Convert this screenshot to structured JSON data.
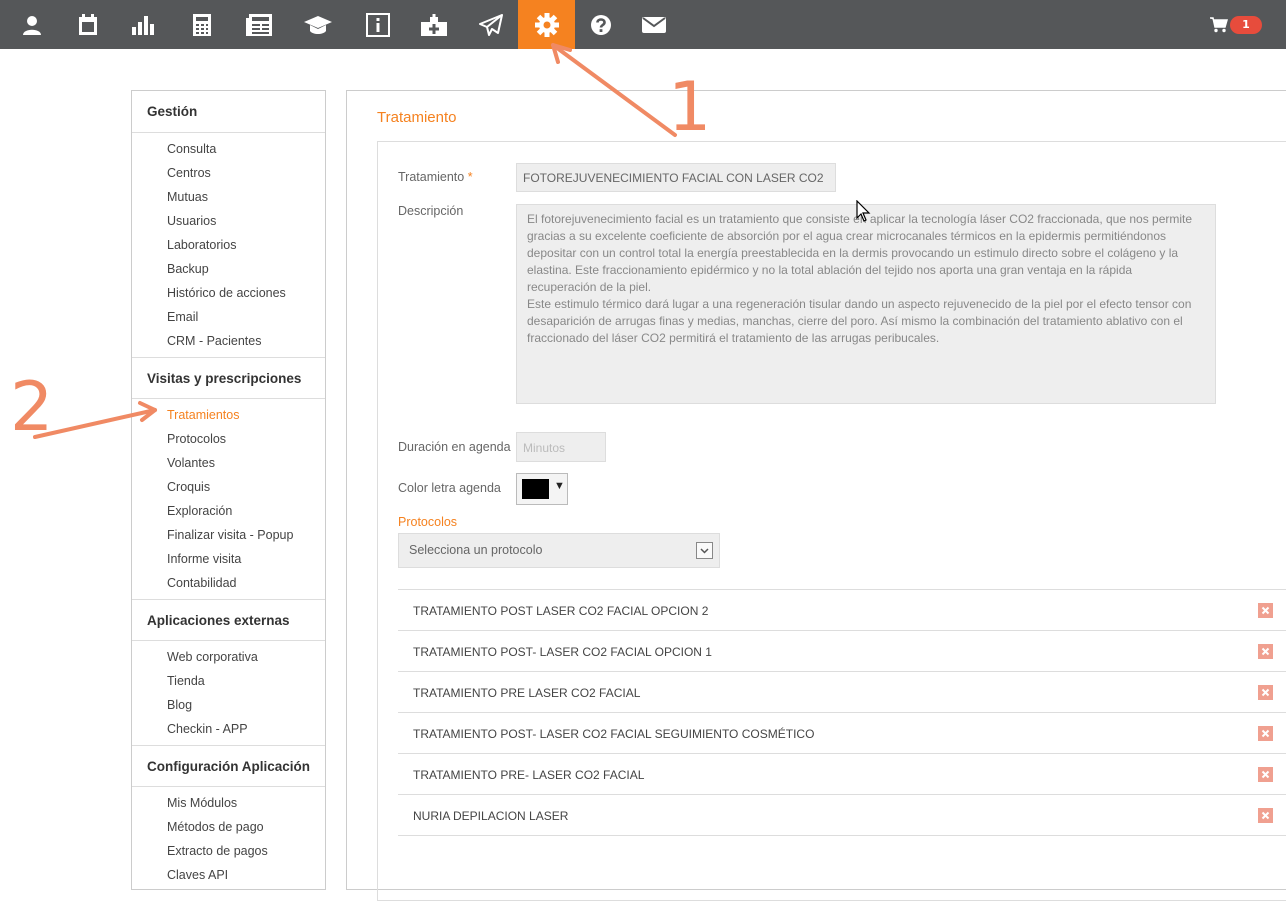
{
  "topbar": {
    "icons": [
      {
        "name": "user-icon"
      },
      {
        "name": "calendar-icon"
      },
      {
        "name": "bar-chart-icon"
      },
      {
        "name": "calculator-icon"
      },
      {
        "name": "newspaper-icon"
      },
      {
        "name": "graduation-cap-icon"
      },
      {
        "name": "info-icon"
      },
      {
        "name": "medkit-icon"
      },
      {
        "name": "paper-plane-icon"
      },
      {
        "name": "gear-icon"
      },
      {
        "name": "question-icon"
      },
      {
        "name": "envelope-icon"
      }
    ],
    "active_icon": "gear-icon",
    "active_color": "#f58220",
    "cart_count": "1"
  },
  "sidebar": {
    "sections": [
      {
        "title": "Gestión",
        "items": [
          "Consulta",
          "Centros",
          "Mutuas",
          "Usuarios",
          "Laboratorios",
          "Backup",
          "Histórico de acciones",
          "Email",
          "CRM - Pacientes"
        ]
      },
      {
        "title": "Visitas y prescripciones",
        "items": [
          "Tratamientos",
          "Protocolos",
          "Volantes",
          "Croquis",
          "Exploración",
          "Finalizar visita - Popup",
          "Informe visita",
          "Contabilidad"
        ]
      },
      {
        "title": "Aplicaciones externas",
        "items": [
          "Web corporativa",
          "Tienda",
          "Blog",
          "Checkin - APP"
        ]
      },
      {
        "title": "Configuración Aplicación",
        "items": [
          "Mis Módulos",
          "Métodos de pago",
          "Extracto de pagos",
          "Claves API"
        ]
      }
    ],
    "active_item": "Tratamientos"
  },
  "main": {
    "title": "Tratamiento",
    "form": {
      "tratamiento_label": "Tratamiento",
      "required_mark": "*",
      "tratamiento_value": "FOTOREJUVENECIMIENTO FACIAL CON LASER CO2",
      "descripcion_label": "Descripción",
      "descripcion_value": "El fotorejuvenecimiento facial es un tratamiento que consiste en aplicar la tecnología láser CO2 fraccionada, que nos permite\ngracias a su excelente coeficiente de absorción por el agua crear microcanales térmicos en la epidermis permitiéndonos\ndepositar con un control total la energía preestablecida en la dermis provocando un estimulo directo sobre el colágeno y la\nelastina. Este fraccionamiento epidérmico y no la total ablación del tejido nos aporta una gran ventaja en la rápida\nrecuperación de la piel.\nEste estimulo térmico dará lugar a una regeneración tisular dando un aspecto rejuvenecido de la piel por el efecto tensor con\ndesaparición de arrugas finas y medias, manchas, cierre del poro. Así mismo la combinación del tratamiento ablativo con el\nfraccionado del láser CO2 permitirá el tratamiento de las arrugas peribucales.",
      "duracion_label": "Duración en agenda",
      "duracion_placeholder": "Minutos",
      "color_label": "Color letra agenda",
      "color_value": "#000000",
      "protocolos_label": "Protocolos",
      "protocolos_select": "Selecciona un protocolo"
    },
    "protocols": [
      "TRATAMIENTO POST LASER CO2 FACIAL OPCION 2",
      "TRATAMIENTO POST- LASER CO2 FACIAL OPCION 1",
      "TRATAMIENTO PRE LASER CO2 FACIAL",
      "TRATAMIENTO POST- LASER CO2 FACIAL SEGUIMIENTO COSMÉTICO",
      "TRATAMIENTO PRE- LASER CO2 FACIAL",
      "NURIA DEPILACION LASER"
    ]
  },
  "annotations": {
    "step1": "1",
    "step2": "2",
    "color": "#f08a64"
  }
}
